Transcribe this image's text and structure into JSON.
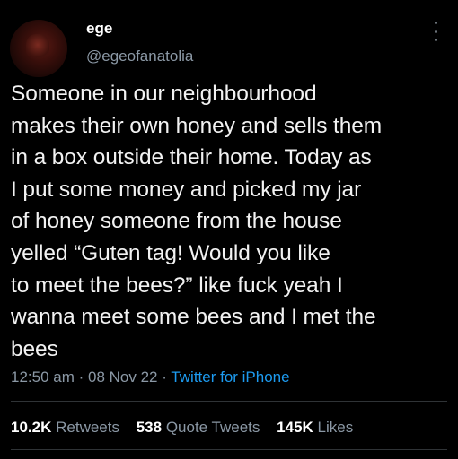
{
  "author": {
    "name": "ege",
    "handle": "@egeofanatolia",
    "avatar": "avatar-dark-red"
  },
  "tweet": {
    "text": "Someone in our neighbourhood\nmakes their own honey and sells them\nin a box outside their home. Today as\nI put some money and picked my jar\nof honey someone from the house\nyelled “Guten tag! Would you like\nto meet the bees?” like fuck yeah I\nwanna meet some bees and I met the\nbees"
  },
  "meta": {
    "time": "12:50 am",
    "sep1": " · ",
    "date": "08 Nov 22",
    "sep2": " · ",
    "source": "Twitter for iPhone"
  },
  "stats": {
    "retweets_count": "10.2K",
    "retweets_label": "Retweets",
    "quotes_count": "538",
    "quotes_label": "Quote Tweets",
    "likes_count": "145K",
    "likes_label": "Likes"
  },
  "icons": {
    "more": "more-vertical-icon"
  },
  "colors": {
    "background": "#000000",
    "text": "#e7e9ea",
    "secondary": "#8b98a5",
    "link": "#1d9bf0"
  }
}
